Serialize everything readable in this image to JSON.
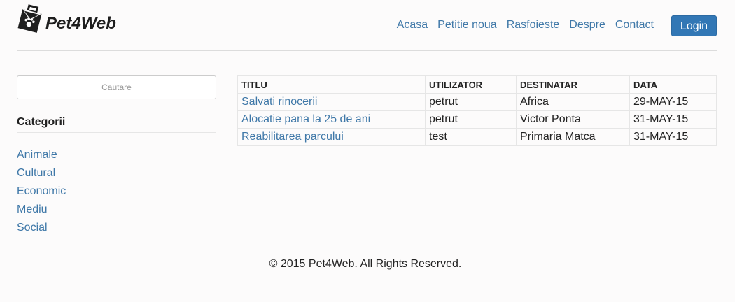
{
  "brand": {
    "name": "Pet4Web",
    "icon": "paw-bag-icon"
  },
  "nav": {
    "items": [
      {
        "label": "Acasa"
      },
      {
        "label": "Petitie noua"
      },
      {
        "label": "Rasfoieste"
      },
      {
        "label": "Despre"
      },
      {
        "label": "Contact"
      }
    ],
    "login_label": "Login"
  },
  "sidebar": {
    "search_placeholder": "Cautare",
    "categories_title": "Categorii",
    "categories": [
      {
        "label": "Animale"
      },
      {
        "label": "Cultural"
      },
      {
        "label": "Economic"
      },
      {
        "label": "Mediu"
      },
      {
        "label": "Social"
      }
    ]
  },
  "table": {
    "headers": [
      "TITLU",
      "UTILIZATOR",
      "DESTINATAR",
      "DATA"
    ],
    "rows": [
      [
        "Salvati rinocerii",
        "petrut",
        "Africa",
        "29-MAY-15"
      ],
      [
        "Alocatie pana la 25 de ani",
        "petrut",
        "Victor Ponta",
        "31-MAY-15"
      ],
      [
        "Reabilitarea parcului",
        "test",
        "Primaria Matca",
        "31-MAY-15"
      ]
    ]
  },
  "footer": {
    "text": "© 2015 Pet4Web. All Rights Reserved."
  },
  "colors": {
    "link": "#3f78a8",
    "primary": "#3277b5",
    "background": "#fcfbfb"
  }
}
